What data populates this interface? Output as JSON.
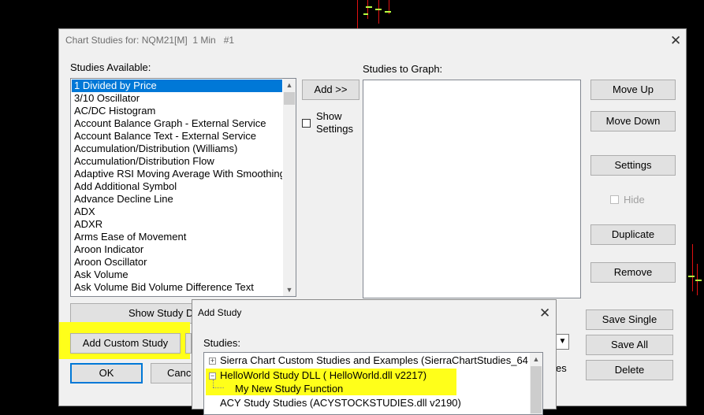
{
  "main_dialog": {
    "title": "Chart Studies for: NQM21[M]  1 Min   #1",
    "studies_available_label": "Studies Available:",
    "studies_to_graph_label": "Studies to Graph:",
    "studies_available": [
      "1 Divided by Price",
      "3/10 Oscillator",
      "AC/DC Histogram",
      "Account Balance Graph - External Service",
      "Account Balance Text - External Service",
      "Accumulation/Distribution (Williams)",
      "Accumulation/Distribution Flow",
      "Adaptive RSI Moving Average With Smoothing",
      "Add Additional Symbol",
      "Advance Decline Line",
      "ADX",
      "ADXR",
      "Arms Ease of Movement",
      "Aroon Indicator",
      "Aroon Oscillator",
      "Ask Volume",
      "Ask Volume Bid Volume Difference Text"
    ],
    "selected_index": 0,
    "add_button": "Add >>",
    "show_settings": "Show\nSettings",
    "move_up": "Move Up",
    "move_down": "Move Down",
    "settings": "Settings",
    "hide": "Hide",
    "duplicate": "Duplicate",
    "remove": "Remove",
    "show_study_d": "Show Study D",
    "add_custom_study": "Add Custom Study",
    "ok": "OK",
    "cancel": "Cance",
    "save_single": "Save Single",
    "save_all": "Save All",
    "delete": "Delete",
    "es_fragment": "es"
  },
  "add_study_dialog": {
    "title": "Add Study",
    "studies_label": "Studies:",
    "tree": [
      {
        "label": "Sierra Chart Custom Studies and Examples (SierraChartStudies_64",
        "expander": "+"
      },
      {
        "label": "HelloWorld  Study DLL ( HelloWorld.dll v2217)",
        "expander": "−"
      },
      {
        "label": "My New Study Function",
        "expander": ""
      },
      {
        "label": "ACY Study Studies (ACYSTOCKSTUDIES.dll v2190)",
        "expander": "+"
      }
    ]
  },
  "icons": {
    "close": "close-icon",
    "scroll_up": "scroll-up-arrow-icon",
    "scroll_down": "scroll-down-arrow-icon",
    "dropdown": "chevron-down-icon"
  },
  "colors": {
    "selection": "#0078d7",
    "highlight": "#ffff1a",
    "background": "#000000"
  }
}
